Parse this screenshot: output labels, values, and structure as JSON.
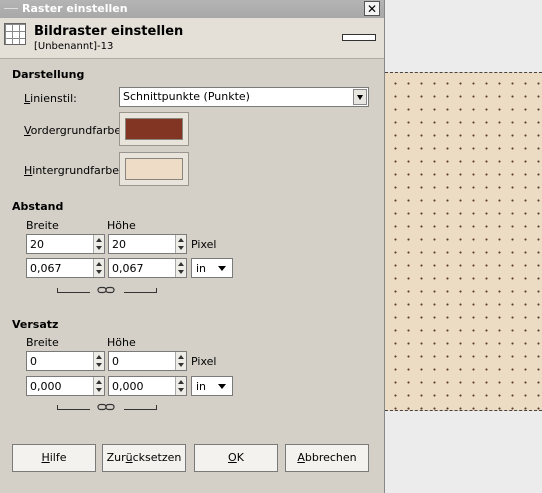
{
  "dialog": {
    "title": "Raster einstellen",
    "close_label": "✕",
    "header_title": "Bildraster einstellen",
    "header_subtitle": "[Unbenannt]-13"
  },
  "darstellung": {
    "section": "Darstellung",
    "linienstil_label_u": "L",
    "linienstil_label_rest": "inienstil:",
    "linienstil_value": "Schnittpunkte (Punkte)",
    "vordergrund_label_u": "V",
    "vordergrund_label_rest": "ordergrundfarbe:",
    "vordergrund_color": "#813522",
    "hintergrund_label_u": "H",
    "hintergrund_label_rest": "intergrundfarbe:",
    "hintergrund_color": "#efdcc6"
  },
  "abstand": {
    "section": "Abstand",
    "breite_label": "Breite",
    "hoehe_label": "Höhe",
    "breite_px": "20",
    "hoehe_px": "20",
    "unit_px": "Pixel",
    "breite_in": "0,067",
    "hoehe_in": "0,067",
    "unit_in": "in"
  },
  "versatz": {
    "section": "Versatz",
    "breite_label": "Breite",
    "hoehe_label": "Höhe",
    "breite_px": "0",
    "hoehe_px": "0",
    "unit_px": "Pixel",
    "breite_in": "0,000",
    "hoehe_in": "0,000",
    "unit_in": "in"
  },
  "buttons": {
    "hilfe_u": "H",
    "hilfe_rest": "ilfe",
    "zuruck_pre": "Zur",
    "zuruck_u": "ü",
    "zuruck_rest": "cksetzen",
    "ok_u": "O",
    "ok_rest": "K",
    "abbrechen_u": "A",
    "abbrechen_rest": "bbrechen"
  },
  "icons": [
    "grid-icon",
    "close-icon",
    "chain-link-icon",
    "dropdown-arrow-icon",
    "spin-arrows-icon"
  ]
}
